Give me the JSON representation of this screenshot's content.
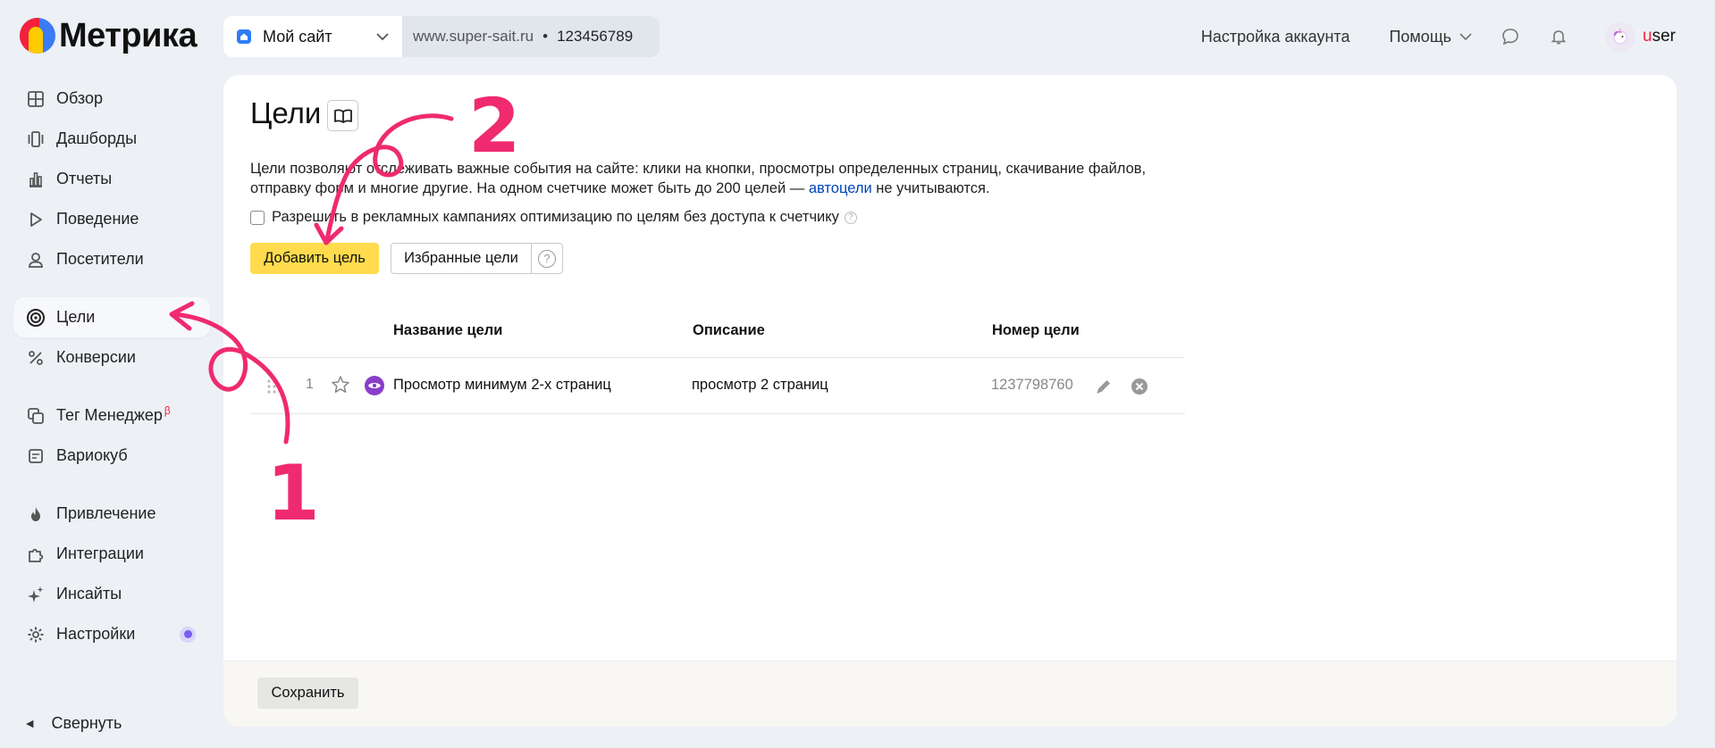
{
  "brand": {
    "name": "Метрика"
  },
  "site": {
    "name": "Мой сайт",
    "url": "www.super-sait.ru",
    "separator": "•",
    "counter_id": "123456789"
  },
  "topbar": {
    "account_settings": "Настройка аккаунта",
    "help": "Помощь"
  },
  "user": {
    "first_letter": "u",
    "rest": "ser"
  },
  "sidebar": {
    "items": [
      {
        "label": "Обзор",
        "icon": "grid-icon"
      },
      {
        "label": "Дашборды",
        "icon": "dashboards-icon"
      },
      {
        "label": "Отчеты",
        "icon": "bar-chart-icon"
      },
      {
        "label": "Поведение",
        "icon": "play-icon"
      },
      {
        "label": "Посетители",
        "icon": "person-icon"
      },
      {
        "label": "Цели",
        "icon": "target-icon",
        "active": true
      },
      {
        "label": "Конверсии",
        "icon": "percent-icon"
      },
      {
        "label": "Тег Менеджер",
        "icon": "tag-manager-icon",
        "superscript": "β"
      },
      {
        "label": "Вариокуб",
        "icon": "variocube-icon"
      },
      {
        "label": "Привлечение",
        "icon": "flame-icon"
      },
      {
        "label": "Интеграции",
        "icon": "puzzle-icon"
      },
      {
        "label": "Инсайты",
        "icon": "sparkle-icon"
      },
      {
        "label": "Настройки",
        "icon": "gear-icon"
      }
    ],
    "collapse": "Свернуть"
  },
  "main": {
    "title": "Цели",
    "description_1": "Цели позволяют отслеживать важные события на сайте: клики на кнопки, просмотры определенных страниц, скачивание файлов, отправку форм и многие другие. На одном счетчике может быть до 200 целей — ",
    "autogoals_link": "автоцели",
    "description_2": " не учитываются.",
    "checkbox_label": "Разрешить в рекламных кампаниях оптимизацию по целям без доступа к счетчику",
    "help_symbol": "?",
    "add_goal": "Добавить цель",
    "favorite_goals": "Избранные цели",
    "table": {
      "headers": {
        "name": "Название цели",
        "description": "Описание",
        "id": "Номер цели"
      },
      "rows": [
        {
          "index": "1",
          "name": "Просмотр минимум 2-х страниц",
          "description": "просмотр 2 страниц",
          "id": "1237798760"
        }
      ]
    },
    "save": "Сохранить"
  },
  "annotations": {
    "step1": "1",
    "step2": "2"
  },
  "colors": {
    "accent_yellow": "#ffdb4d",
    "annotation_pink": "#ef2a6f",
    "link_blue": "#0044bb",
    "goal_purple": "#8a3ec8"
  }
}
